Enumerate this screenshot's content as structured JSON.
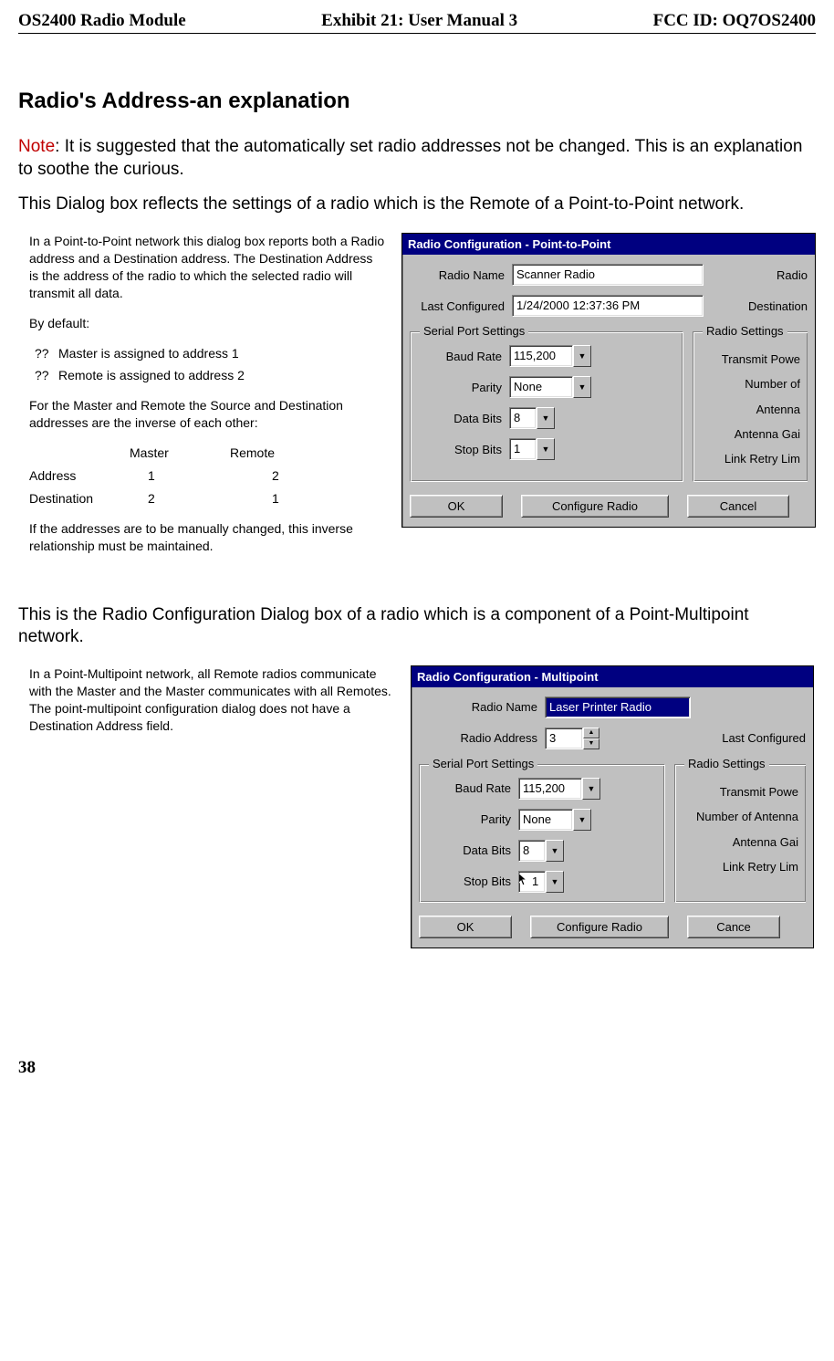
{
  "header": {
    "left": "OS2400 Radio Module",
    "center": "Exhibit 21: User Manual 3",
    "right": "FCC ID: OQ7OS2400"
  },
  "section_title": "Radio's Address-an explanation",
  "note": {
    "label": "Note",
    "text": ":  It is suggested that the automatically set radio addresses not be changed.  This is an explanation to soothe the curious."
  },
  "para_ptp_intro": "This Dialog box reflects the settings of a radio which is the Remote of a Point-to-Point network.",
  "ptp_left": {
    "p1": "In a Point-to-Point network this dialog box reports both a Radio address and a Destination address.  The Destination Address is the address of the radio to which the selected radio will transmit all data.",
    "p2": "By default:",
    "bullet_prefix": "??",
    "b1": "Master is assigned to address 1",
    "b2": "Remote is assigned to address 2",
    "p3": "For the Master and Remote the Source and Destination addresses are the inverse of each other:",
    "table": {
      "h1": "",
      "h2": "Master",
      "h3": "Remote",
      "r1c1": "Address",
      "r1c2": "1",
      "r1c3": "2",
      "r2c1": "Destination",
      "r2c2": "2",
      "r2c3": "1"
    },
    "p4": "If the addresses are to be manually changed, this inverse relationship must be maintained."
  },
  "ptp_dialog": {
    "title": "Radio Configuration - Point-to-Point",
    "radio_name_label": "Radio Name",
    "radio_name_value": "Scanner Radio",
    "radio_cut": "Radio",
    "last_configured_label": "Last Configured",
    "last_configured_value": "1/24/2000 12:37:36 PM",
    "destination_cut": "Destination",
    "group_serial": "Serial Port Settings",
    "baud_label": "Baud Rate",
    "baud_value": "115,200",
    "parity_label": "Parity",
    "parity_value": "None",
    "databits_label": "Data Bits",
    "databits_value": "8",
    "stopbits_label": "Stop Bits",
    "stopbits_value": "1",
    "group_radio": "Radio Settings",
    "rs1": "Transmit Powe",
    "rs2": "Number of Antenna",
    "rs3": "Antenna Gai",
    "rs4": "Link Retry Lim",
    "ok": "OK",
    "configure": "Configure Radio",
    "cancel": "Cancel"
  },
  "para_mp_intro": "This is the Radio Configuration Dialog box of a radio which is a component of a Point-Multipoint network.",
  "mp_left": {
    "p1": "In a Point-Multipoint network, all Remote radios communicate with the Master and the Master communicates with all Remotes.  The point-multipoint configuration dialog does not have a Destination Address field."
  },
  "mp_dialog": {
    "title": "Radio Configuration - Multipoint",
    "radio_name_label": "Radio Name",
    "radio_name_value": "Laser Printer Radio",
    "radio_address_label": "Radio Address",
    "radio_address_value": "3",
    "last_configured_label": "Last Configured",
    "group_serial": "Serial Port Settings",
    "baud_label": "Baud Rate",
    "baud_value": "115,200",
    "parity_label": "Parity",
    "parity_value": "None",
    "databits_label": "Data Bits",
    "databits_value": "8",
    "stopbits_label": "Stop Bits",
    "stopbits_value": "1",
    "group_radio": "Radio Settings",
    "rs1": "Transmit Powe",
    "rs2": "Number of Antenna",
    "rs3": "Antenna Gai",
    "rs4": "Link Retry Lim",
    "ok": "OK",
    "configure": "Configure Radio",
    "cancel": "Cance"
  },
  "page_number": "38"
}
